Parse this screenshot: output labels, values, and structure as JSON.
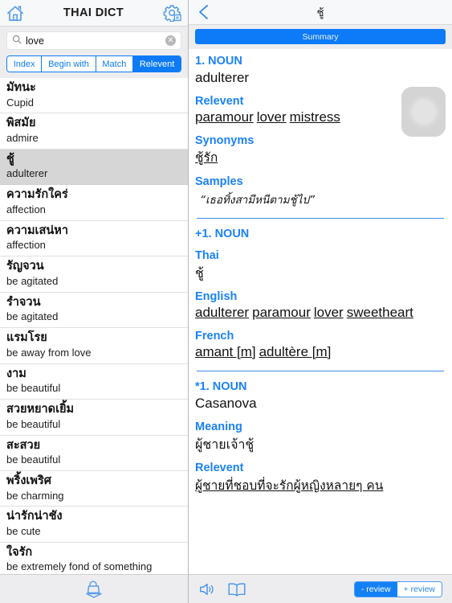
{
  "left": {
    "navbar": {
      "home_icon": "home-icon",
      "title": "THAI DICT",
      "settings_icon": "gear-icon"
    },
    "search": {
      "icon": "search-icon",
      "value": "love",
      "placeholder": "Search",
      "clear_icon": "clear-icon",
      "clear_glyph": "✕"
    },
    "segments": [
      {
        "label": "Index",
        "active": false
      },
      {
        "label": "Begin with",
        "active": false
      },
      {
        "label": "Match",
        "active": false
      },
      {
        "label": "Relevent",
        "active": true
      }
    ],
    "results": [
      {
        "thai": "มัทนะ",
        "english": "Cupid",
        "selected": false
      },
      {
        "thai": "พิสมัย",
        "english": "admire",
        "selected": false
      },
      {
        "thai": "ชู้",
        "english": "adulterer",
        "selected": true
      },
      {
        "thai": "ความรักใคร่",
        "english": "affection",
        "selected": false
      },
      {
        "thai": "ความเสน่หา",
        "english": "affection",
        "selected": false
      },
      {
        "thai": "รัญจวน",
        "english": "be agitated",
        "selected": false
      },
      {
        "thai": "รำจวน",
        "english": "be agitated",
        "selected": false
      },
      {
        "thai": "แรมโรย",
        "english": "be away from love",
        "selected": false
      },
      {
        "thai": "งาม",
        "english": "be beautiful",
        "selected": false
      },
      {
        "thai": "สวยหยาดเยิ้ม",
        "english": "be beautiful",
        "selected": false
      },
      {
        "thai": "สะสวย",
        "english": "be beautiful",
        "selected": false
      },
      {
        "thai": "พริ้งเพริศ",
        "english": "be charming",
        "selected": false
      },
      {
        "thai": "น่ารักน่าชัง",
        "english": "be cute",
        "selected": false
      },
      {
        "thai": "ใจรัก",
        "english": "be extremely fond of something",
        "selected": false
      }
    ],
    "toolbar": {
      "download_icon": "shopping-bag-download-icon"
    }
  },
  "right": {
    "navbar": {
      "back_icon": "back-chevron-icon",
      "title": "ชู้"
    },
    "summary_button": "Summary",
    "assistive_touch": "assistive-touch-button",
    "entries": [
      {
        "heading": "1. NOUN",
        "headword": "adulterer",
        "fields": [
          {
            "label": "Relevent",
            "type": "links",
            "links": [
              "paramour",
              "lover",
              "mistress"
            ]
          },
          {
            "label": "Synonyms",
            "type": "thai-link",
            "value": "ชู้รัก"
          },
          {
            "label": "Samples",
            "type": "sample",
            "value": "“เธอทิ้งสามีหนีตามชู้ไป”"
          }
        ]
      },
      {
        "heading": "+1. NOUN",
        "headword": "",
        "fields": [
          {
            "label": "Thai",
            "type": "thai",
            "value": "ชู้"
          },
          {
            "label": "English",
            "type": "links",
            "links": [
              "adulterer",
              "paramour",
              "lover",
              "sweetheart"
            ]
          },
          {
            "label": "French",
            "type": "links",
            "links": [
              "amant [m]",
              "adultère [m]"
            ]
          }
        ]
      },
      {
        "heading": "*1. NOUN",
        "headword": "Casanova",
        "fields": [
          {
            "label": "Meaning",
            "type": "thai",
            "value": "ผู้ชายเจ้าชู้"
          },
          {
            "label": "Relevent",
            "type": "thai-link",
            "value": "ผู้ชายที่ชอบที่จะรักผู้หญิงหลายๆ คน"
          }
        ]
      }
    ],
    "toolbar": {
      "speaker_icon": "speaker-icon",
      "book_icon": "book-icon",
      "review_minus": "- review",
      "review_plus": "+ review"
    }
  },
  "colors": {
    "accent": "#0d7bf7",
    "label": "#1a82f7",
    "chrome": "#ededf0"
  }
}
